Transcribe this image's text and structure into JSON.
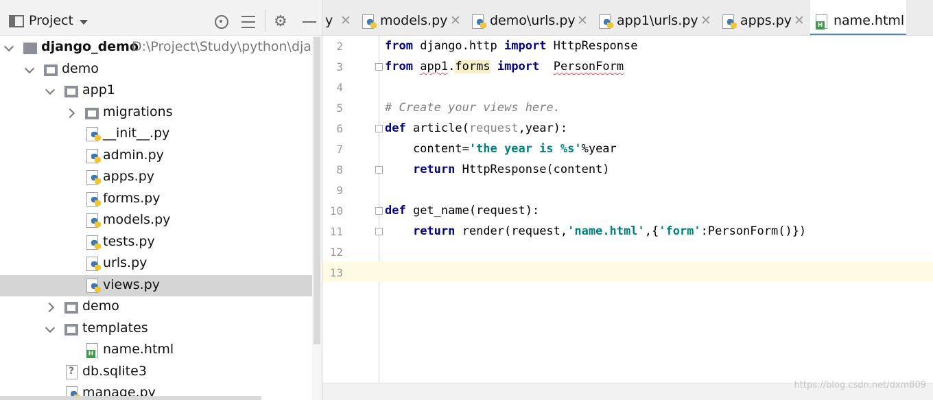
{
  "project_panel": {
    "title": "Project",
    "tree": [
      {
        "label": "django_demo",
        "path": "D:\\Project\\Study\\python\\djangodemo",
        "type": "project",
        "expanded": true,
        "level": 0
      },
      {
        "label": "demo",
        "type": "folder",
        "expanded": true,
        "level": 1
      },
      {
        "label": "app1",
        "type": "folder",
        "expanded": true,
        "level": 2
      },
      {
        "label": "migrations",
        "type": "folder",
        "expanded": false,
        "level": 3
      },
      {
        "label": "__init__.py",
        "type": "python",
        "level": 3
      },
      {
        "label": "admin.py",
        "type": "python",
        "level": 3
      },
      {
        "label": "apps.py",
        "type": "python",
        "level": 3
      },
      {
        "label": "forms.py",
        "type": "python",
        "level": 3
      },
      {
        "label": "models.py",
        "type": "python",
        "level": 3
      },
      {
        "label": "tests.py",
        "type": "python",
        "level": 3
      },
      {
        "label": "urls.py",
        "type": "python",
        "level": 3
      },
      {
        "label": "views.py",
        "type": "python",
        "level": 3,
        "selected": true
      },
      {
        "label": "demo",
        "type": "folder",
        "expanded": false,
        "level": 2
      },
      {
        "label": "templates",
        "type": "folder",
        "expanded": true,
        "level": 2
      },
      {
        "label": "name.html",
        "type": "html",
        "level": 3
      },
      {
        "label": "db.sqlite3",
        "type": "db",
        "level": 2
      },
      {
        "label": "manage.py",
        "type": "python",
        "level": 2
      }
    ]
  },
  "tabs": [
    {
      "label": "y",
      "icon": "python-file-icon",
      "partial": true
    },
    {
      "label": "models.py",
      "icon": "python-file-icon"
    },
    {
      "label": "demo\\urls.py",
      "icon": "python-file-icon"
    },
    {
      "label": "app1\\urls.py",
      "icon": "python-file-icon"
    },
    {
      "label": "apps.py",
      "icon": "python-file-icon"
    },
    {
      "label": "name.html",
      "icon": "html-file-icon",
      "active": true
    }
  ],
  "editor": {
    "lines": [
      {
        "no": "2",
        "text": "from django.http import HttpResponse"
      },
      {
        "no": "3",
        "text": "from app1.forms import  PersonForm"
      },
      {
        "no": "4",
        "text": ""
      },
      {
        "no": "5",
        "text": "# Create your views here."
      },
      {
        "no": "6",
        "text": "def article(request,year):"
      },
      {
        "no": "7",
        "text": "    content='the year is %s'%year"
      },
      {
        "no": "8",
        "text": "    return HttpResponse(content)"
      },
      {
        "no": "9",
        "text": ""
      },
      {
        "no": "10",
        "text": "def get_name(request):"
      },
      {
        "no": "11",
        "text": "    return render(request,'name.html',{'form':PersonForm()})"
      },
      {
        "no": "12",
        "text": ""
      },
      {
        "no": "13",
        "text": ""
      }
    ],
    "current_line": "13",
    "watermark": "https://blog.csdn.net/dxm809"
  },
  "colors": {
    "keyword": "#000080",
    "string": "#008080",
    "comment": "#808080",
    "current_line_bg": "#fffae3",
    "selection_bg": "#d5d5d5",
    "active_tab_underline": "#4a88c7"
  }
}
